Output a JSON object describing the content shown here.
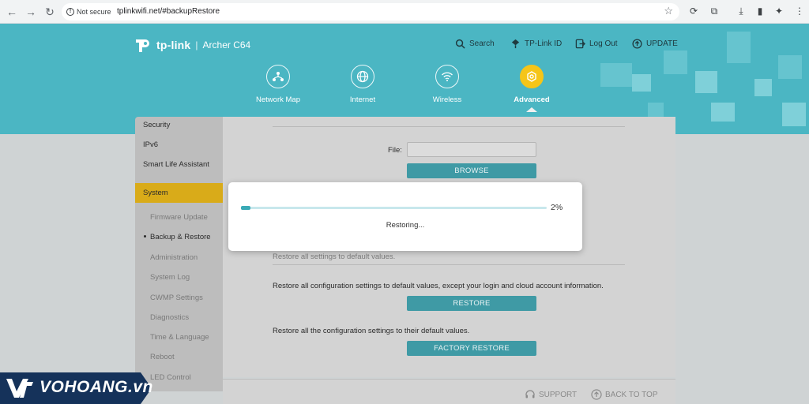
{
  "browser": {
    "security_label": "Not secure",
    "url": "tplinkwifi.net/#backupRestore"
  },
  "header": {
    "brand": "tp-link",
    "separator": "|",
    "model": "Archer C64",
    "links": [
      {
        "label": "Search",
        "icon": "search-icon"
      },
      {
        "label": "TP-Link ID",
        "icon": "id-icon"
      },
      {
        "label": "Log Out",
        "icon": "logout-icon"
      },
      {
        "label": "UPDATE",
        "icon": "update-icon"
      }
    ],
    "nav": [
      {
        "label": "Network Map",
        "icon": "network-map-icon",
        "active": false
      },
      {
        "label": "Internet",
        "icon": "globe-icon",
        "active": false
      },
      {
        "label": "Wireless",
        "icon": "wifi-icon",
        "active": false
      },
      {
        "label": "Advanced",
        "icon": "gear-icon",
        "active": true
      }
    ],
    "accent_color": "#4bb6c3",
    "active_color": "#f5c518"
  },
  "sidebar": {
    "items": [
      "Security",
      "IPv6",
      "Smart Life Assistant",
      "System"
    ],
    "active_item": "System",
    "sub_items": [
      "Firmware Update",
      "Backup & Restore",
      "Administration",
      "System Log",
      "CWMP Settings",
      "Diagnostics",
      "Time & Language",
      "Reboot",
      "LED Control"
    ],
    "current_sub_item": "Backup & Restore"
  },
  "main": {
    "file_label": "File:",
    "file_value": "",
    "browse_button": "BROWSE",
    "factory_default_note": "Restore all settings to default values.",
    "restore_text": "Restore all configuration settings to default values, except your login and cloud account information.",
    "restore_button": "RESTORE",
    "factory_text": "Restore all the configuration settings to their default values.",
    "factory_button": "FACTORY RESTORE"
  },
  "footer": {
    "support": "SUPPORT",
    "back_to_top": "BACK TO TOP"
  },
  "modal": {
    "progress_percent": 2,
    "progress_label": "2%",
    "message": "Restoring..."
  },
  "watermark": {
    "text": "VOHOANG.vn"
  }
}
